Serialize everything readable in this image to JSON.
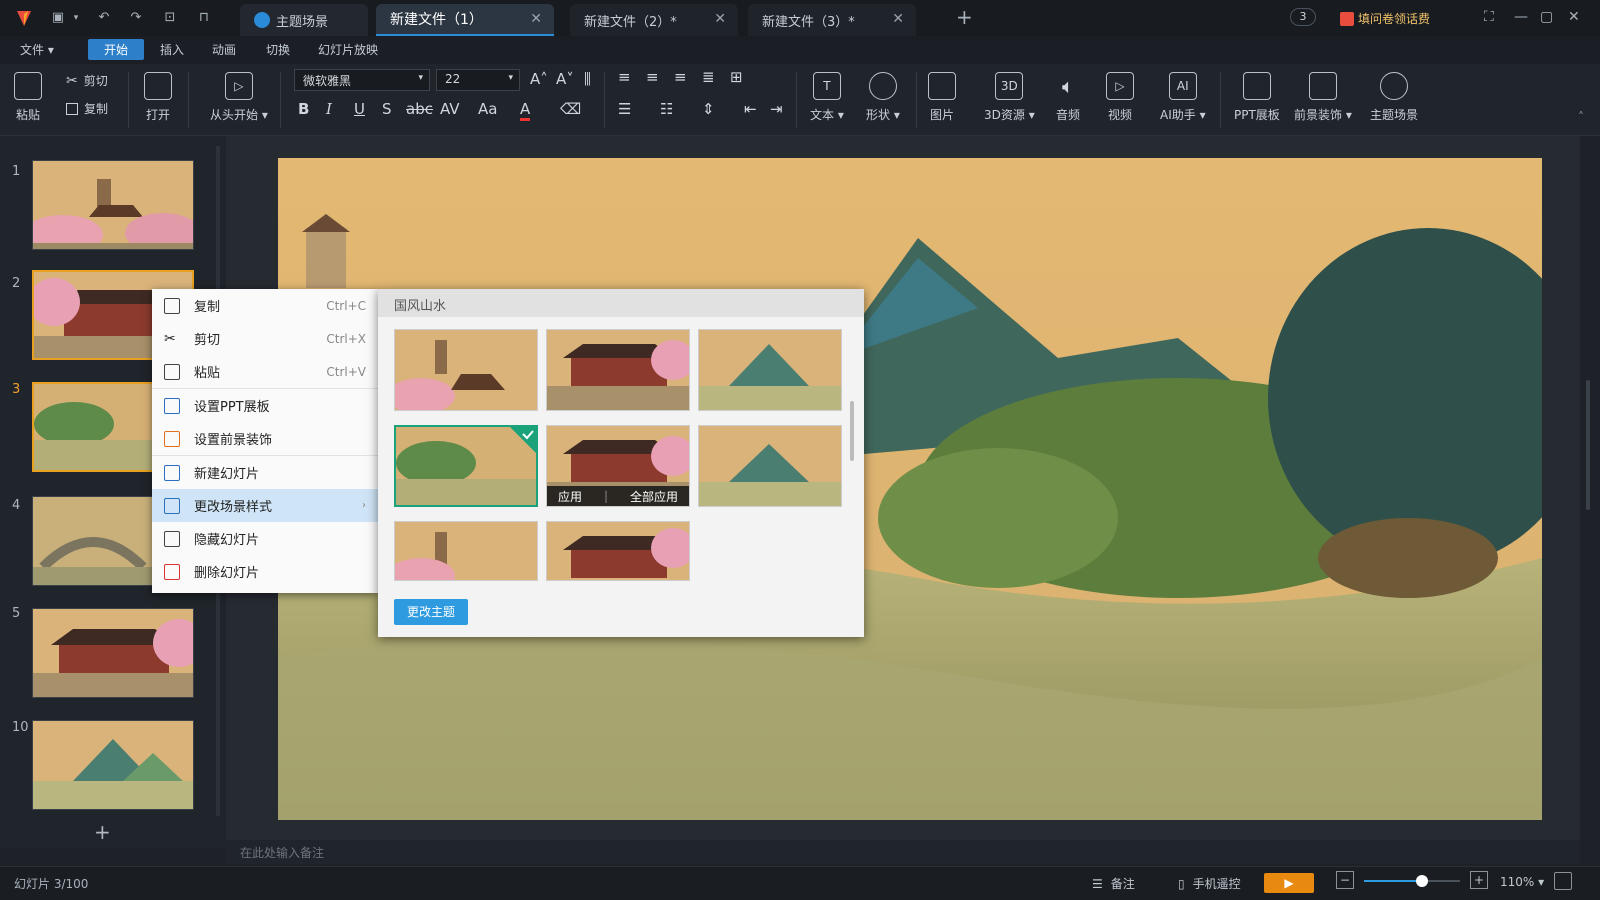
{
  "titlebar": {
    "tabs": [
      {
        "label": "主题场景"
      },
      {
        "label": "新建文件（1）"
      },
      {
        "label": "新建文件（2）*"
      },
      {
        "label": "新建文件（3）*"
      }
    ],
    "badge_count": "3",
    "survey": "填问卷领话费"
  },
  "menubar": {
    "file": "文件",
    "items": [
      "开始",
      "插入",
      "动画",
      "切换",
      "幻灯片放映"
    ]
  },
  "ribbon": {
    "paste": "粘贴",
    "cut": "剪切",
    "copy": "复制",
    "open": "打开",
    "from_start": "从头开始",
    "font_name": "微软雅黑",
    "font_size": "22",
    "text": "文本",
    "shape": "形状",
    "image": "图片",
    "res3d": "3D资源",
    "audio": "音频",
    "video": "视频",
    "ai": "AI助手",
    "ppt_board": "PPT展板",
    "foreground": "前景装饰",
    "theme_scene": "主题场景",
    "icon3d": "3D",
    "iconai": "AI"
  },
  "thumbnails": [
    "1",
    "2",
    "3",
    "4",
    "5",
    "10"
  ],
  "context_menu": {
    "items": [
      {
        "label": "复制",
        "shortcut": "Ctrl+C"
      },
      {
        "label": "剪切",
        "shortcut": "Ctrl+X"
      },
      {
        "label": "粘贴",
        "shortcut": "Ctrl+V"
      },
      {
        "label": "设置PPT展板",
        "shortcut": ""
      },
      {
        "label": "设置前景装饰",
        "shortcut": ""
      },
      {
        "label": "新建幻灯片",
        "shortcut": ""
      },
      {
        "label": "更改场景样式",
        "shortcut": ""
      },
      {
        "label": "隐藏幻灯片",
        "shortcut": ""
      },
      {
        "label": "删除幻灯片",
        "shortcut": ""
      }
    ]
  },
  "scene_panel": {
    "title": "国风山水",
    "apply": "应用",
    "apply_all": "全部应用",
    "change_theme": "更改主题"
  },
  "notes_placeholder": "在此处输入备注",
  "status": {
    "slide_info": "幻灯片 3/100",
    "notes": "备注",
    "remote": "手机遥控",
    "zoom": "110%",
    "zoom_level_fraction": 0.6
  },
  "colors": {
    "accent": "#2e7fc9",
    "selected_border": "#e8a020",
    "play_button": "#e88a10"
  }
}
